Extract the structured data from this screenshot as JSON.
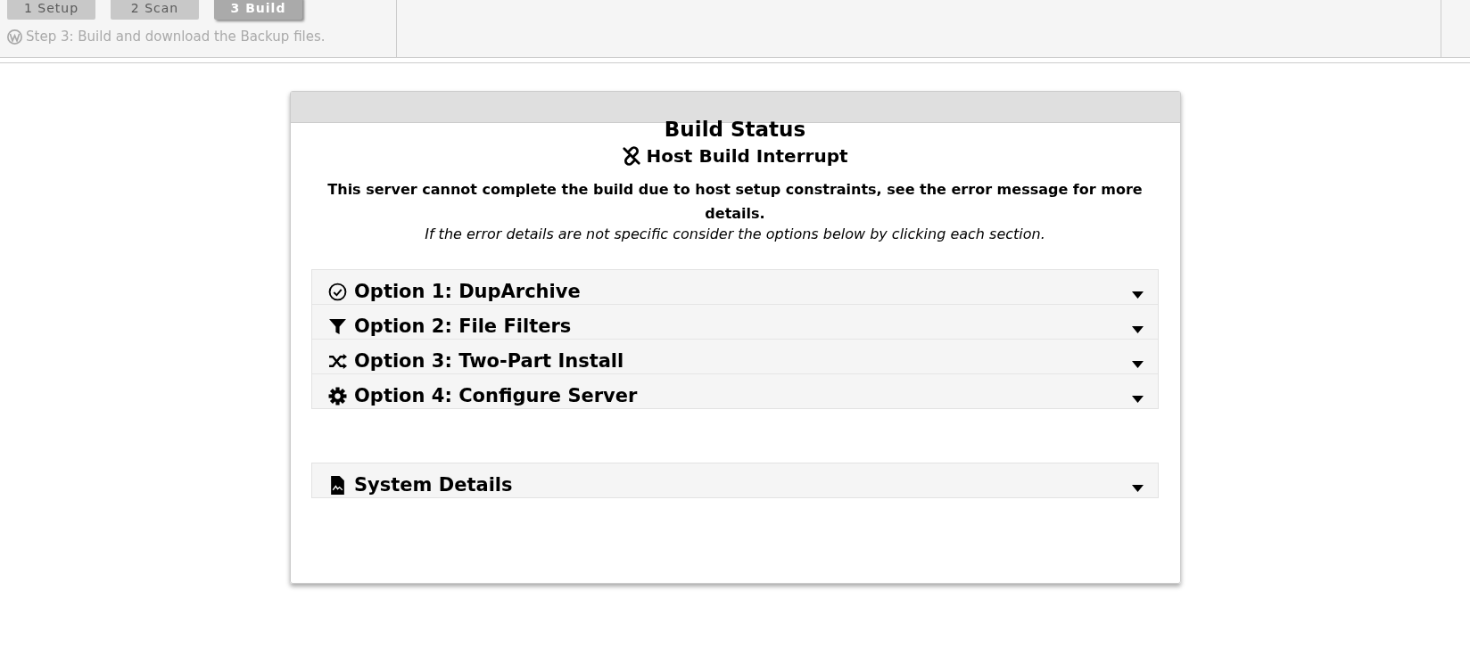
{
  "steps": [
    {
      "label": "1 Setup",
      "selected": false
    },
    {
      "label": "2 Scan",
      "selected": false
    },
    {
      "label": "3 Build",
      "selected": true
    }
  ],
  "step_description": "Step 3: Build and download the Backup files.",
  "card": {
    "title": "Build Status",
    "subtitle": "Host Build Interrupt",
    "message": "This server cannot complete the build due to host setup constraints, see the error message for more details.",
    "hint": "If the error details are not specific consider the options below by clicking each section."
  },
  "options": [
    {
      "kind": "check",
      "title": "Option 1: DupArchive"
    },
    {
      "kind": "filter",
      "title": "Option 2: File Filters"
    },
    {
      "kind": "shuffle",
      "title": "Option 3: Two-Part Install"
    },
    {
      "kind": "gear",
      "title": "Option 4: Configure Server"
    }
  ],
  "details": [
    {
      "kind": "file",
      "title": "System Details"
    }
  ]
}
